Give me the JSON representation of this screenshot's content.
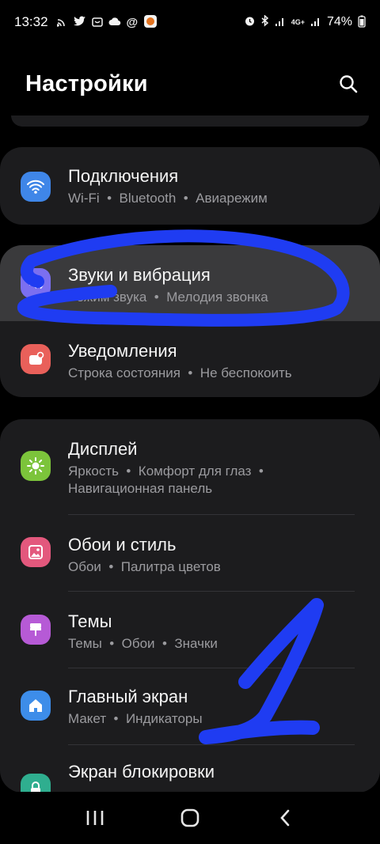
{
  "status_bar": {
    "time": "13:32",
    "battery": "74%",
    "network": "4G+",
    "left_icons": [
      "cast-icon",
      "twitter-icon",
      "gift-icon",
      "cloud-icon",
      "at-icon",
      "app-icon"
    ],
    "right_icons": [
      "alarm-icon",
      "bluetooth-icon",
      "signal-icon",
      "signal-icon",
      "battery-icon"
    ]
  },
  "header": {
    "title": "Настройки"
  },
  "groups": [
    {
      "items": [
        {
          "title": "Подключения",
          "subtitle": "Wi-Fi  •  Bluetooth  •  Авиарежим",
          "icon": "wifi-icon",
          "color": "#3f86e8"
        }
      ]
    },
    {
      "items": [
        {
          "title": "Звуки и вибрация",
          "subtitle": "Режим звука  •  Мелодия звонка",
          "icon": "speaker-icon",
          "color": "#7b6ff0"
        },
        {
          "title": "Уведомления",
          "subtitle": "Строка состояния  •  Не беспокоить",
          "icon": "notification-icon",
          "color": "#e9605a"
        }
      ]
    },
    {
      "items": [
        {
          "title": "Дисплей",
          "subtitle": "Яркость  •  Комфорт для глаз  •",
          "subtitle2": "Навигационная панель",
          "icon": "sun-icon",
          "color": "#7cc43b"
        },
        {
          "title": "Обои и стиль",
          "subtitle": "Обои  •  Палитра цветов",
          "icon": "wallpaper-icon",
          "color": "#e3587d"
        },
        {
          "title": "Темы",
          "subtitle": "Темы  •  Обои  •  Значки",
          "icon": "brush-icon",
          "color": "#b65ad6"
        },
        {
          "title": "Главный экран",
          "subtitle": "Макет  •  Индикаторы",
          "icon": "home-icon",
          "color": "#3d8de9"
        },
        {
          "title": "Экран блокировки",
          "subtitle": "",
          "icon": "lock-icon",
          "color": "#2fae8f"
        }
      ]
    }
  ],
  "annotation": {
    "color": "#1f3cf2"
  },
  "nav_bar": {
    "icons": [
      "recents-icon",
      "home-button-icon",
      "back-icon"
    ]
  }
}
